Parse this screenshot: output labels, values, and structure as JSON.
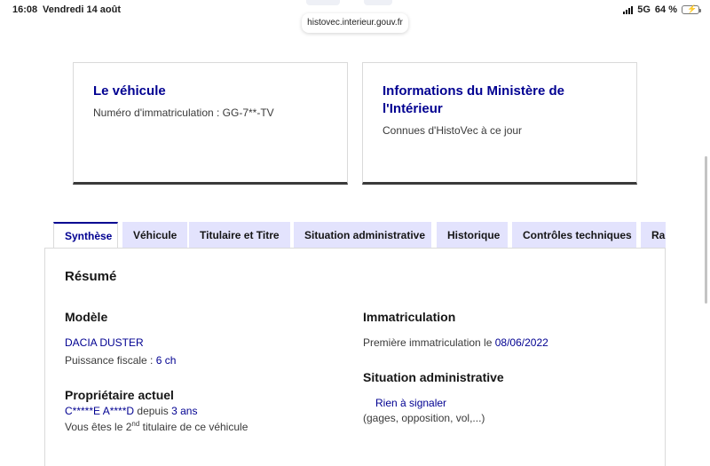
{
  "status_bar": {
    "time": "16:08",
    "date": "Vendredi 14 août",
    "network": "5G",
    "battery": "64 %",
    "battery_level": 0.64
  },
  "browser": {
    "url": "histovec.interieur.gouv.fr"
  },
  "cards": [
    {
      "title": "Le véhicule",
      "subtitle": "Numéro d'immatriculation : GG-7**-TV"
    },
    {
      "title": "Informations du Ministère de l'Intérieur",
      "subtitle": "Connues d'HistoVec à ce jour"
    }
  ],
  "tabs": [
    {
      "label": "Synthèse",
      "active": true
    },
    {
      "label": "Véhicule"
    },
    {
      "label": "Titulaire et Titre"
    },
    {
      "label": "Situation administrative"
    },
    {
      "label": "Historique"
    },
    {
      "label": "Contrôles techniques"
    },
    {
      "label": "Ra"
    }
  ],
  "summary": {
    "title": "Résumé",
    "model_heading": "Modèle",
    "model_value": "DACIA DUSTER",
    "fiscal_power_label": "Puissance fiscale :",
    "fiscal_power_value": "6 ch",
    "owner_heading": "Propriétaire actuel",
    "owner_name": "C*****E A****D",
    "owner_since_label": "depuis",
    "owner_since_value": "3 ans",
    "owner_rank_prefix": "Vous êtes le 2",
    "owner_rank_sup": "nd",
    "owner_rank_suffix": " titulaire de ce véhicule",
    "registration_heading": "Immatriculation",
    "first_registration_label": "Première immatriculation le",
    "first_registration_date": "08/06/2022",
    "admin_heading": "Situation administrative",
    "admin_value": "Rien à signaler",
    "admin_note": "(gages, opposition, vol,...)"
  },
  "colors": {
    "accent": "#000091",
    "tab_background": "#e3e3fd",
    "battery_fill": "#35c759"
  }
}
